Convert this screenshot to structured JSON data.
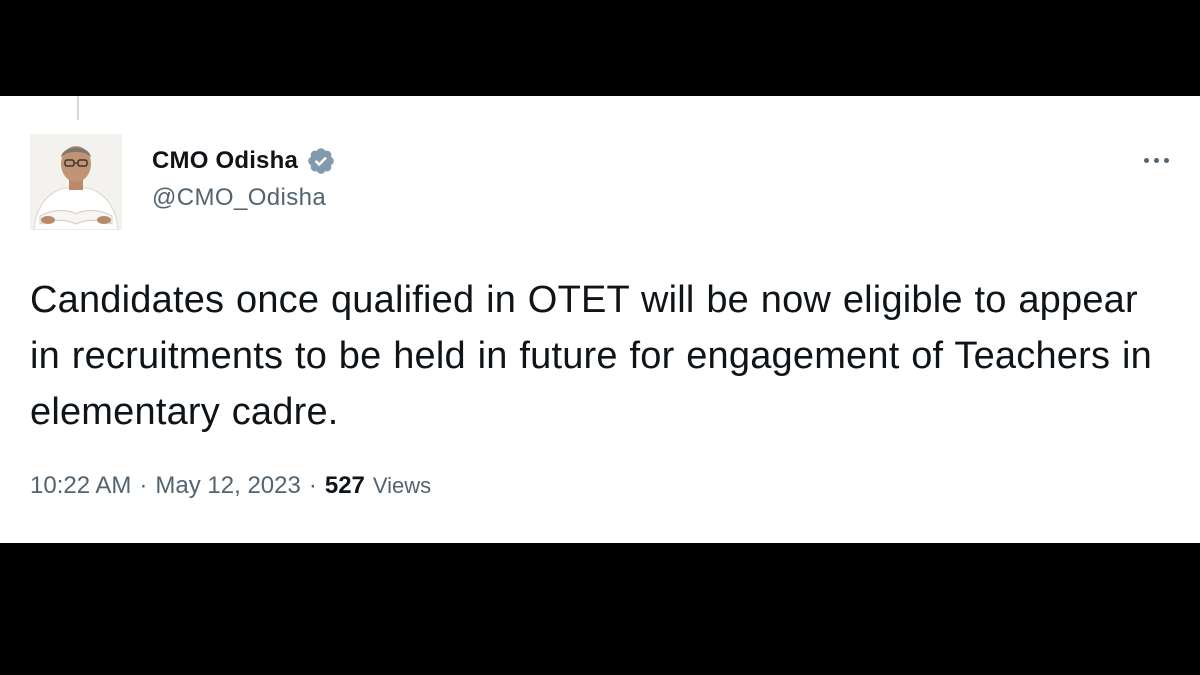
{
  "tweet": {
    "author": {
      "display_name": "CMO Odisha",
      "handle": "@CMO_Odisha",
      "verified": true
    },
    "text": "Candidates once qualified in OTET will be now eligible to appear in recruitments to be held in future for engagement of Teachers in elementary cadre.",
    "time": "10:22 AM",
    "separator": "·",
    "date": "May 12, 2023",
    "views_count": "527",
    "views_label": "Views"
  },
  "icons": {
    "verified": "verified-badge-icon",
    "more": "more-options-icon"
  },
  "colors": {
    "background": "#ffffff",
    "letterbox": "#000000",
    "primary_text": "#0f1419",
    "secondary_text": "#536471",
    "verified_badge": "#829aab"
  }
}
